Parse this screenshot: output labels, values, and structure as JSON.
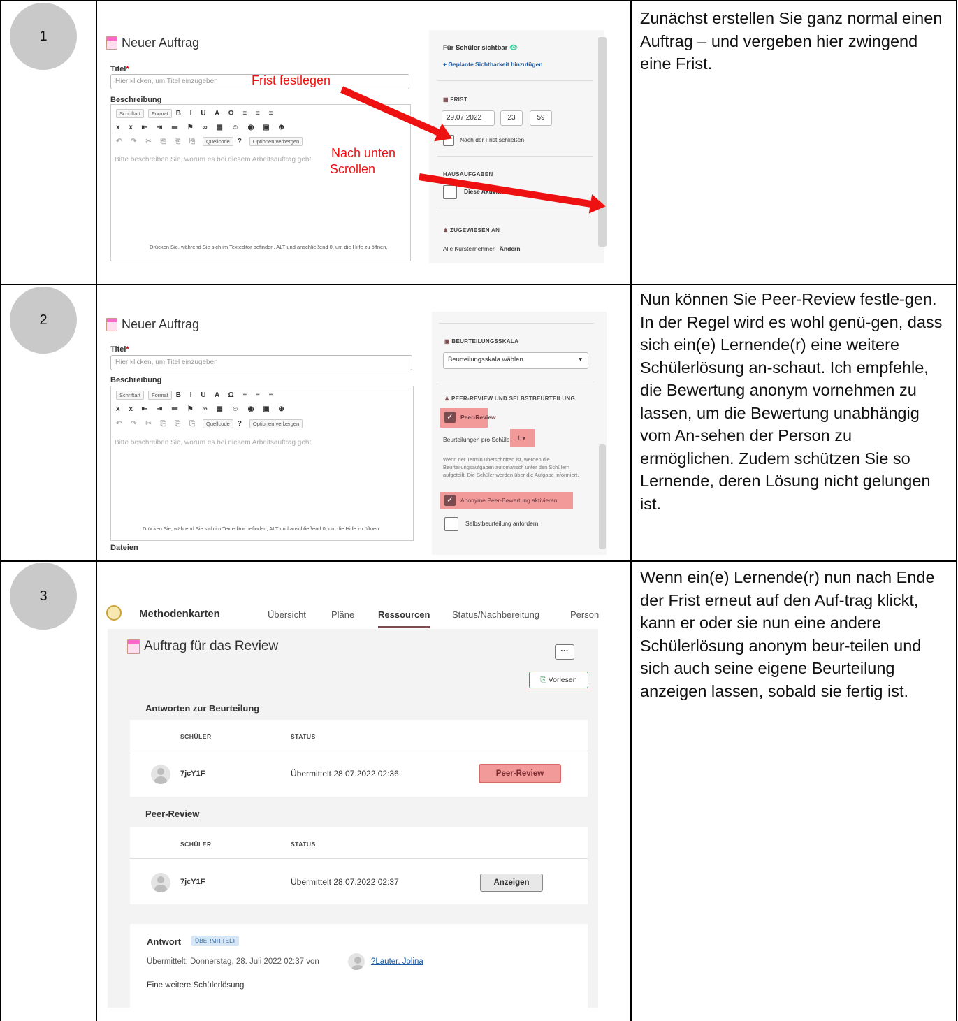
{
  "steps": [
    {
      "number": "1",
      "text": "Zunächst erstellen Sie ganz normal einen Auftrag – und vergeben hier zwingend eine Frist."
    },
    {
      "number": "2",
      "text": "Nun können Sie Peer-Review festle-gen. In der Regel wird es wohl genü-gen, dass sich ein(e) Lernende(r) eine weitere Schülerlösung an-schaut. Ich empfehle, die Bewertung anonym vornehmen zu lassen, um die Bewertung unabhängig vom An-sehen der Person zu ermöglichen. Zudem schützen Sie so Lernende, deren Lösung nicht gelungen ist."
    },
    {
      "number": "3",
      "text": "Wenn ein(e) Lernende(r) nun nach Ende der Frist erneut auf den Auf-trag klickt, kann er oder sie nun eine andere Schülerlösung anonym beur-teilen und sich auch seine eigene Beurteilung anzeigen lassen, sobald sie fertig ist."
    }
  ],
  "editor": {
    "title": "Neuer Auftrag",
    "title_label": "Titel",
    "required_mark": "*",
    "title_placeholder": "Hier klicken, um Titel einzugeben",
    "description_label": "Beschreibung",
    "toolbar_font": "Schriftart",
    "toolbar_format": "Format",
    "toolbar_source": "Quellcode",
    "toolbar_help": "?",
    "toolbar_hide": "Optionen verbergen",
    "desc_placeholder": "Bitte beschreiben Sie, worum es bei diesem Arbeitsauftrag geht.",
    "editor_hint": "Drücken Sie, während Sie sich im Texteditor befinden, ALT und anschließend 0, um die Hilfe zu öffnen.",
    "files_label": "Dateien"
  },
  "panel1": {
    "visible_label": "Für Schüler sichtbar",
    "add_visibility": "+ Geplante Sichtbarkeit hinzufügen",
    "deadline_heading": "FRIST",
    "deadline_date": "29.07.2022",
    "deadline_hour": "23",
    "deadline_minute": "59",
    "close_after": "Nach der Frist schließen",
    "homework_heading": "HAUSAUFGABEN",
    "homework_text": "Diese Aktivität ist eine",
    "assigned_heading": "ZUGEWIESEN AN",
    "assigned_value": "Alle Kursteilnehmer",
    "assigned_change": "Ändern",
    "annot_deadline": "Frist festlegen",
    "annot_scroll_1": "Nach unten",
    "annot_scroll_2": "Scrollen"
  },
  "panel2": {
    "scale_heading": "BEURTEILUNGSSKALA",
    "scale_select": "Beurteilungsskala wählen",
    "peer_heading": "PEER-REVIEW UND SELBSTBEURTEILUNG",
    "peer_review": "Peer-Review",
    "per_student": "Beurteilungen pro Schüler",
    "per_student_value": "1",
    "info": "Wenn der Termin überschritten ist, werden die Beurteilungsaufgaben automatisch unter den Schülern aufgeteilt. Die Schüler werden über die Aufgabe informiert.",
    "anonymous": "Anonyme Peer-Bewertung aktivieren",
    "self_assessment": "Selbstbeurteilung anfordern"
  },
  "course": {
    "brand": "Methodenkarten",
    "tabs": [
      "Übersicht",
      "Pläne",
      "Ressourcen",
      "Status/Nachbereitung",
      "Person"
    ],
    "assignment_title": "Auftrag für das Review",
    "more": "···",
    "read_aloud": "Vorlesen",
    "section_answers": "Antworten zur Beurteilung",
    "col_student": "SCHÜLER",
    "col_status": "STATUS",
    "row1_name": "7jcY1F",
    "row1_status": "Übermittelt 28.07.2022 02:36",
    "row1_button": "Peer-Review",
    "section_peer": "Peer-Review",
    "row2_name": "7jcY1F",
    "row2_status": "Übermittelt 28.07.2022 02:37",
    "row2_button": "Anzeigen",
    "answer_label": "Antwort",
    "answer_badge": "ÜBERMITTELT",
    "answer_meta": "Übermittelt: Donnerstag, 28. Juli 2022 02:37 von",
    "answer_author": "?Lauter, Jolina",
    "answer_text": "Eine weitere Schülerlösung"
  }
}
